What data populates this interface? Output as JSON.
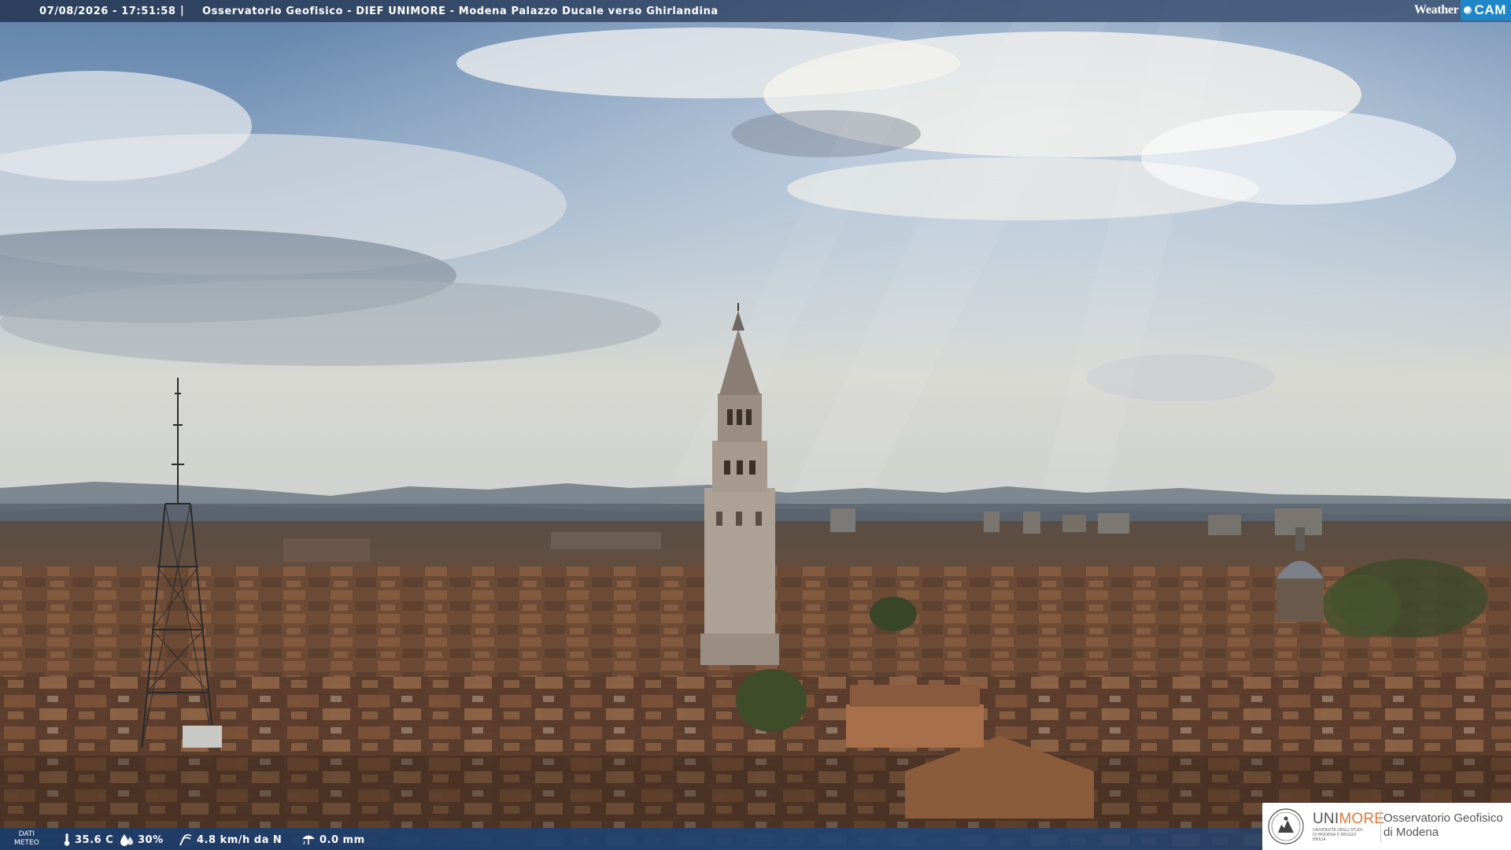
{
  "overlay": {
    "datetime": "07/08/2026 - 17:51:58",
    "separator": "|",
    "location": "Osservatorio Geofisico - DIEF UNIMORE - Modena Palazzo Ducale verso Ghirlandina"
  },
  "brand": {
    "weather": "Weather",
    "cam": "CAM",
    "color": "#1f86c8"
  },
  "weather_data": {
    "label_line1": "DATI",
    "label_line2": "METEO",
    "temperature": "35.6 C",
    "temperature_icon": "thermometer-icon",
    "humidity": "30%",
    "humidity_icon": "humidity-drop-icon",
    "wind": "4.8 km/h da N",
    "wind_icon": "wind-icon",
    "rain": "0.0 mm",
    "rain_icon": "rain-gauge-icon"
  },
  "logo": {
    "uni": "UNI",
    "more": "MORE",
    "subtitle": "UNIVERSITÀ DEGLI STUDI DI MODENA E REGGIO EMILIA",
    "observatory_line1": "Osservatorio Geofisico",
    "observatory_line2": "di Modena",
    "accent_color": "#e0783a"
  },
  "scene": {
    "description_icon": "city-skyline-image"
  }
}
